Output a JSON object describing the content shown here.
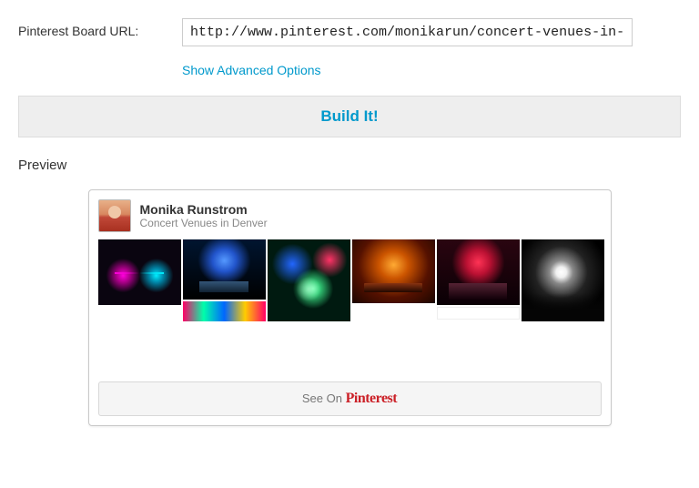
{
  "form": {
    "url_label": "Pinterest Board URL:",
    "url_value": "http://www.pinterest.com/monikarun/concert-venues-in-de",
    "advanced_link": "Show Advanced Options",
    "build_button": "Build It!"
  },
  "preview": {
    "section_label": "Preview",
    "author_name": "Monika Runstrom",
    "board_title": "Concert Venues in Denver",
    "see_on_prefix": "See On ",
    "pinterest_brand": "Pinterest"
  }
}
